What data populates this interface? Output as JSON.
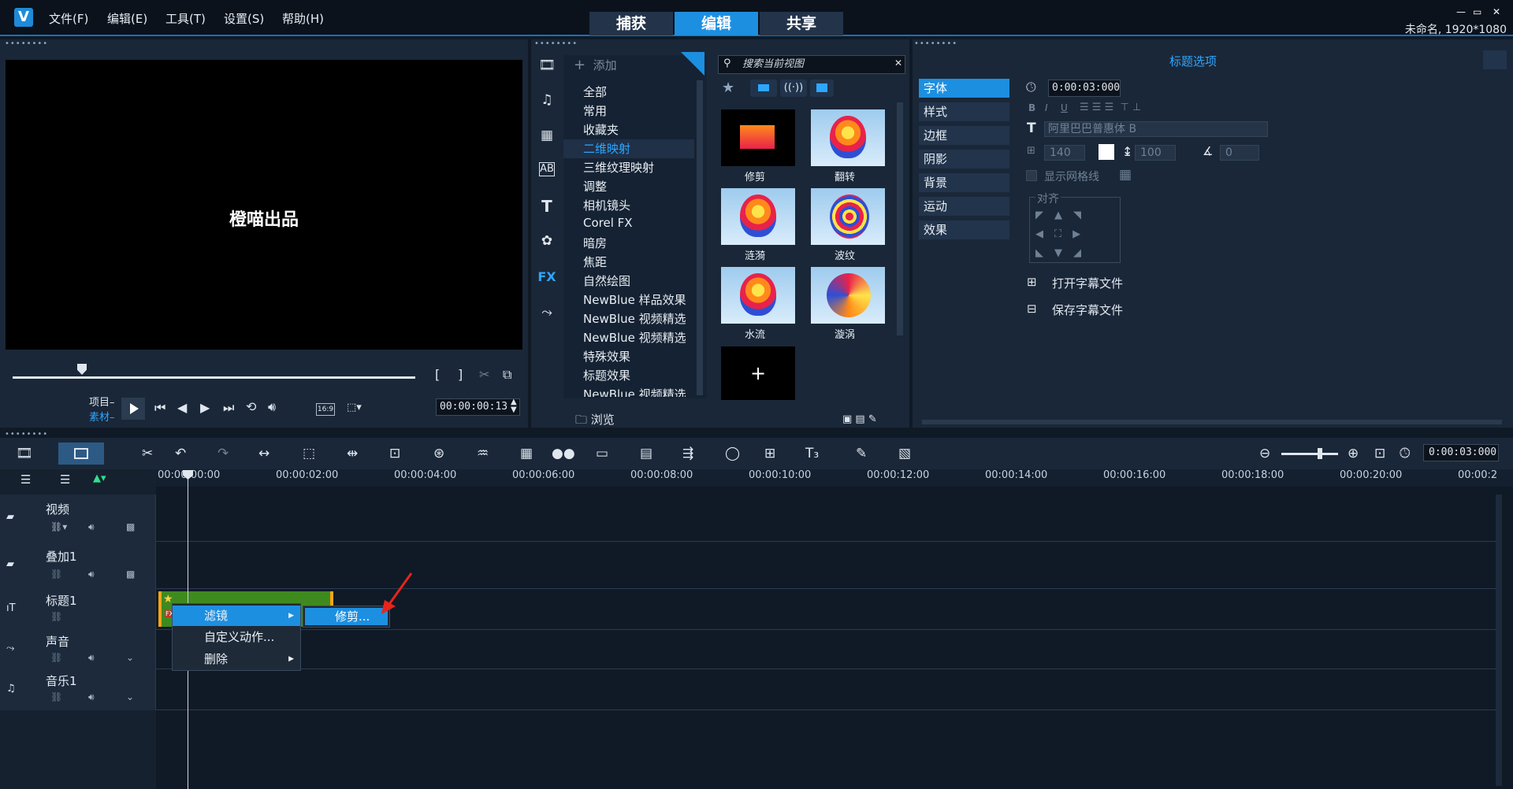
{
  "app": {
    "logo": "V",
    "menu": [
      "文件(F)",
      "编辑(E)",
      "工具(T)",
      "设置(S)",
      "帮助(H)"
    ],
    "main_tabs": [
      "捕获",
      "编辑",
      "共享"
    ],
    "project_info": "未命名, 1920*1080",
    "window_controls": [
      "—",
      "▭",
      "✕"
    ]
  },
  "preview": {
    "dots": "••••••••",
    "screen_text": "橙喵出品",
    "mode_project": "项目",
    "mode_clip": "素材",
    "aspect": "16:9",
    "timecode": "00:00:00:13"
  },
  "library": {
    "dots": "••••••••",
    "add_label": "添加",
    "categories": [
      "全部",
      "常用",
      "收藏夹",
      "二维映射",
      "三维纹理映射",
      "调整",
      "相机镜头",
      "Corel FX",
      "暗房",
      "焦距",
      "自然绘图",
      "NewBlue 样品效果",
      "NewBlue 视频精选",
      "NewBlue 视频精选",
      "特殊效果",
      "标题效果",
      "NewBlue 视频精选"
    ],
    "selected_category": "二维映射",
    "browse_label": "浏览",
    "search_placeholder": "搜索当前视图",
    "thumbnails": [
      "修剪",
      "翻转",
      "涟漪",
      "波纹",
      "水流",
      "漩涡"
    ],
    "add_thumb": "+"
  },
  "options": {
    "dots": "••••••••",
    "title": "标题选项",
    "tabs": [
      "字体",
      "样式",
      "边框",
      "阴影",
      "背景",
      "运动",
      "效果"
    ],
    "active_tab": "字体",
    "duration": "0:00:03:000",
    "font_name": "阿里巴巴普惠体 B",
    "font_size": "140",
    "line_spacing": "100",
    "rotation": "0",
    "show_grid": "显示网格线",
    "align_label": "对齐",
    "open_subtitle": "打开字幕文件",
    "save_subtitle": "保存字幕文件",
    "format_buttons": [
      "B",
      "I",
      "U"
    ]
  },
  "timeline": {
    "dots": "••••••••",
    "zoom_timecode": "0:00:03:000",
    "ruler": [
      "00:00:00:00",
      "00:00:02:00",
      "00:00:04:00",
      "00:00:06:00",
      "00:00:08:00",
      "00:00:10:00",
      "00:00:12:00",
      "00:00:14:00",
      "00:00:16:00",
      "00:00:18:00",
      "00:00:20:00",
      "00:00:2"
    ],
    "tracks": [
      "视频",
      "叠加1",
      "标题1",
      "声音",
      "音乐1"
    ],
    "clip_badge": "FX"
  },
  "context_menu": {
    "items": [
      "滤镜",
      "自定义动作...",
      "删除"
    ],
    "active_item": "滤镜",
    "submenu_item": "修剪..."
  }
}
